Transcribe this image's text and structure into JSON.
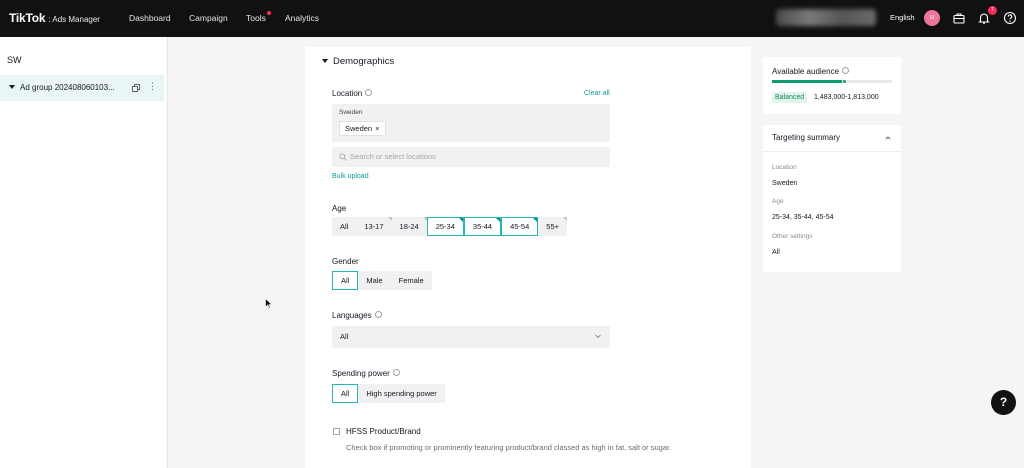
{
  "topbar": {
    "logo_main": "TikTok",
    "logo_sub": ": Ads Manager",
    "nav": [
      "Dashboard",
      "Campaign",
      "Tools",
      "Analytics"
    ],
    "language": "English",
    "avatar_initial": "u",
    "notification_count": "1"
  },
  "sidebar": {
    "account": "SW",
    "ad_group": "Ad group 202408060103..."
  },
  "demographics": {
    "title": "Demographics",
    "location": {
      "label": "Location",
      "clear_all": "Clear all",
      "group": "Sweden",
      "chip": "Sweden",
      "search_placeholder": "Search or select locations",
      "bulk_upload": "Bulk upload"
    },
    "age": {
      "label": "Age",
      "options": [
        "All",
        "13-17",
        "18-24",
        "25-34",
        "35-44",
        "45-54",
        "55+"
      ]
    },
    "gender": {
      "label": "Gender",
      "options": [
        "All",
        "Male",
        "Female"
      ]
    },
    "languages": {
      "label": "Languages",
      "value": "All"
    },
    "spending_power": {
      "label": "Spending power",
      "options": [
        "All",
        "High spending power"
      ]
    },
    "hfss": {
      "label": "HFSS Product/Brand",
      "description": "Check box if promoting or prominently featuring product/brand classed as high in fat, salt or sugar."
    }
  },
  "audience": {
    "title": "Available audience",
    "status": "Balanced",
    "range": "1,483,000-1,813,000",
    "level_percent": 60,
    "status_color": "#0f9b6a"
  },
  "summary": {
    "title": "Targeting summary",
    "location_key": "Location",
    "location_value": "Sweden",
    "age_key": "Age",
    "age_value": "25-34, 35-44, 45-54",
    "other_key": "Other settings",
    "other_value": "All"
  },
  "help": {
    "glyph": "?"
  },
  "colors": {
    "accent": "#25b5b5",
    "brand_pink": "#fe2c55",
    "topbar": "#111111"
  }
}
